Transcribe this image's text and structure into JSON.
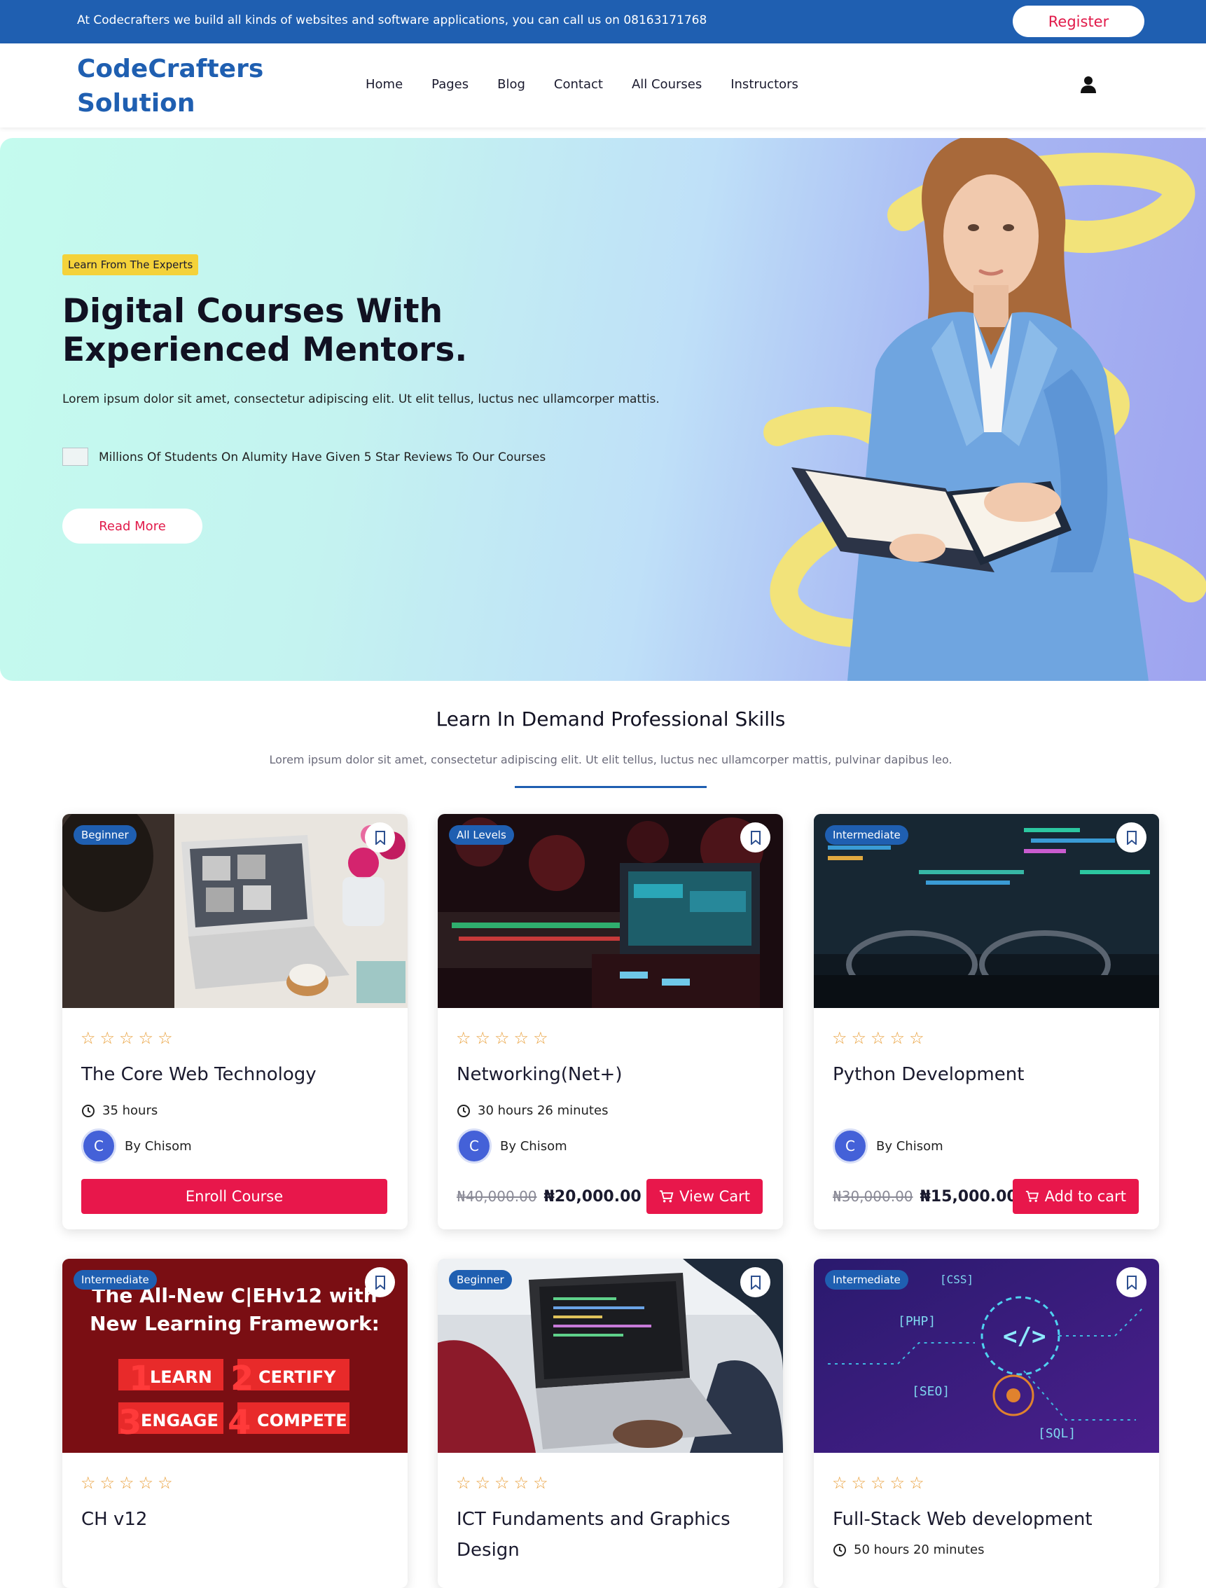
{
  "topbar": {
    "text": "At Codecrafters we build all kinds of websites and software applications, you can call us on 08163171768",
    "register_label": "Register"
  },
  "header": {
    "logo": "CodeCrafters\nSolution",
    "nav": [
      "Home",
      "Pages",
      "Blog",
      "Contact",
      "All Courses",
      "Instructors"
    ],
    "user_icon": "user-icon"
  },
  "hero": {
    "badge": "Learn From The Experts",
    "title": "Digital Courses With Experienced Mentors.",
    "description": "Lorem ipsum dolor sit amet, consectetur adipiscing elit. Ut elit tellus, luctus nec ullamcorper mattis.",
    "reviews_text": "Millions Of Students On Alumity Have Given 5 Star Reviews To Our Courses",
    "read_more_label": "Read More"
  },
  "section": {
    "title": "Learn In Demand Professional Skills",
    "subtitle": "Lorem ipsum dolor sit amet, consectetur adipiscing elit. Ut elit tellus, luctus nec ullamcorper mattis, pulvinar dapibus leo."
  },
  "courses": [
    {
      "level": "Beginner",
      "title": "The Core Web Technology",
      "duration": "35 hours",
      "author": "By Chisom",
      "avatar_initial": "C",
      "action": "Enroll Course",
      "rating": 0
    },
    {
      "level": "All Levels",
      "title": "Networking(Net+)",
      "duration": "30 hours 26 minutes",
      "author": "By Chisom",
      "avatar_initial": "C",
      "old_price": "₦40,000.00",
      "price": "₦20,000.00",
      "action": "View Cart",
      "rating": 0
    },
    {
      "level": "Intermediate",
      "title": "Python Development",
      "duration": "",
      "author": "By Chisom",
      "avatar_initial": "C",
      "old_price": "₦30,000.00",
      "price": "₦15,000.00",
      "action": "Add to cart",
      "rating": 0
    },
    {
      "level": "Intermediate",
      "title": "CH v12",
      "rating": 0,
      "image_text": {
        "line1": "The All-New C|EHv12 with",
        "line2": "New Learning Framework:",
        "n1": "1",
        "w1": "LEARN",
        "n2": "2",
        "w2": "CERTIFY",
        "n3": "3",
        "w3": "ENGAGE",
        "n4": "4",
        "w4": "COMPETE"
      }
    },
    {
      "level": "Beginner",
      "title": "ICT Fundaments and Graphics Design",
      "rating": 0
    },
    {
      "level": "Intermediate",
      "title": "Full-Stack Web development",
      "duration": "50 hours 20 minutes",
      "rating": 0,
      "image_text": {
        "php": "[PHP]",
        "css": "[CSS]",
        "seo": "[SEO]",
        "sql": "[SQL]",
        "code": "</>"
      }
    }
  ],
  "colors": {
    "brand_blue": "#1f5fb1",
    "accent_red": "#e8174b",
    "badge_yellow": "#f4d23a",
    "star_orange": "#e9a03c"
  }
}
